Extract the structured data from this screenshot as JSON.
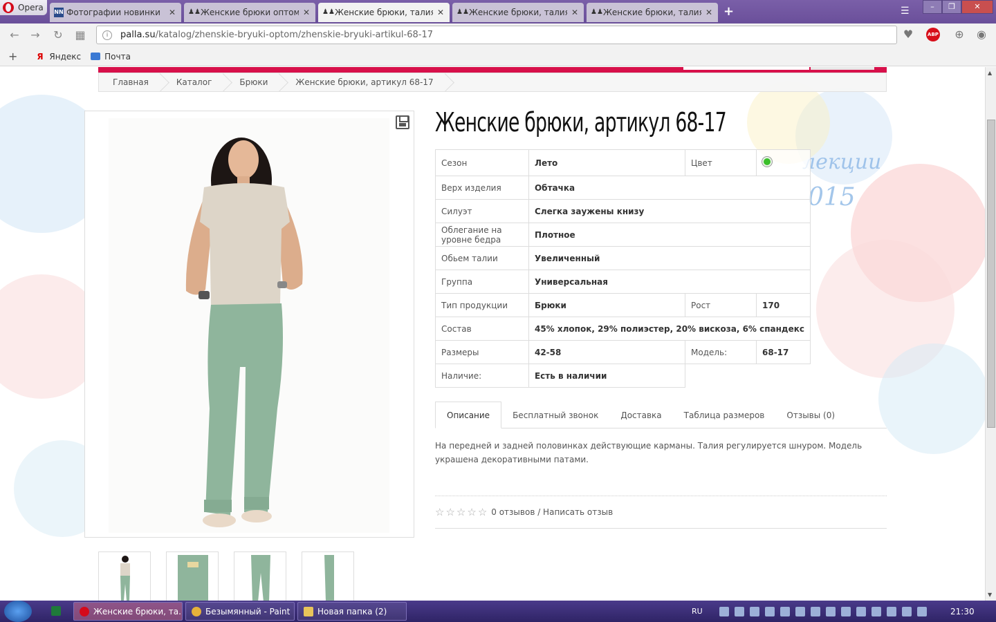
{
  "browser": {
    "name": "Opera",
    "tabs": [
      {
        "label": "Фотографии новинки",
        "icon": "nn-icon"
      },
      {
        "label": "Женские брюки оптом ку",
        "icon": "palla-icon"
      },
      {
        "label": "Женские брюки, талия ре",
        "icon": "palla-icon",
        "active": true
      },
      {
        "label": "Женские брюки, талия ув",
        "icon": "palla-icon"
      },
      {
        "label": "Женские брюки, талия ув",
        "icon": "palla-icon"
      }
    ],
    "url_host": "palla.su",
    "url_path": "/katalog/zhenskie-bryuki-optom/zhenskie-bryuki-artikul-68-17",
    "abp_label": "ABP",
    "bookmarks": [
      "Яндекс",
      "Почта"
    ]
  },
  "page": {
    "breadcrumb": [
      "Главная",
      "Каталог",
      "Брюки",
      "Женские брюки, артикул 68-17"
    ],
    "title": "Женские брюки, артикул 68-17",
    "specs": {
      "season_label": "Сезон",
      "season_value": "Лето",
      "color_label": "Цвет",
      "color_value": "#3bbf2b",
      "top_label": "Верх изделия",
      "top_value": "Обтачка",
      "silhouette_label": "Силуэт",
      "silhouette_value": "Слегка заужены книзу",
      "hip_label": "Облегание на уровне бедра",
      "hip_value": "Плотное",
      "waist_label": "Обьем талии",
      "waist_value": "Увеличенный",
      "group_label": "Группа",
      "group_value": "Универсальная",
      "type_label": "Тип продукции",
      "type_value": "Брюки",
      "height_label": "Рост",
      "height_value": "170",
      "composition_label": "Состав",
      "composition_value": "45% хлопок, 29% полиэстер, 20% вискоза, 6% спандекс",
      "sizes_label": "Размеры",
      "sizes_value": "42-58",
      "model_label": "Модель:",
      "model_value": "68-17",
      "availability_label": "Наличие:",
      "availability_value": "Есть в наличии"
    },
    "tabs": [
      "Описание",
      "Бесплатный звонок",
      "Доставка",
      "Таблица размеров",
      "Отзывы (0)"
    ],
    "description": "На передней и задней половинках действующие карманы. Талия регулируется шнуром. Модель украшена декоративными патами.",
    "reviews_text": "0 отзывов / Написать отзыв",
    "rating": 0,
    "watermark_1": "лекции",
    "watermark_2": "015"
  },
  "taskbar": {
    "tasks": [
      "Женские брюки, та...",
      "Безымянный - Paint",
      "Новая папка (2)"
    ],
    "lang": "RU",
    "clock": "21:30"
  },
  "colors": {
    "brand": "#d7104a",
    "chrome": "#6a4f9a",
    "pants": "#8fb59c"
  }
}
